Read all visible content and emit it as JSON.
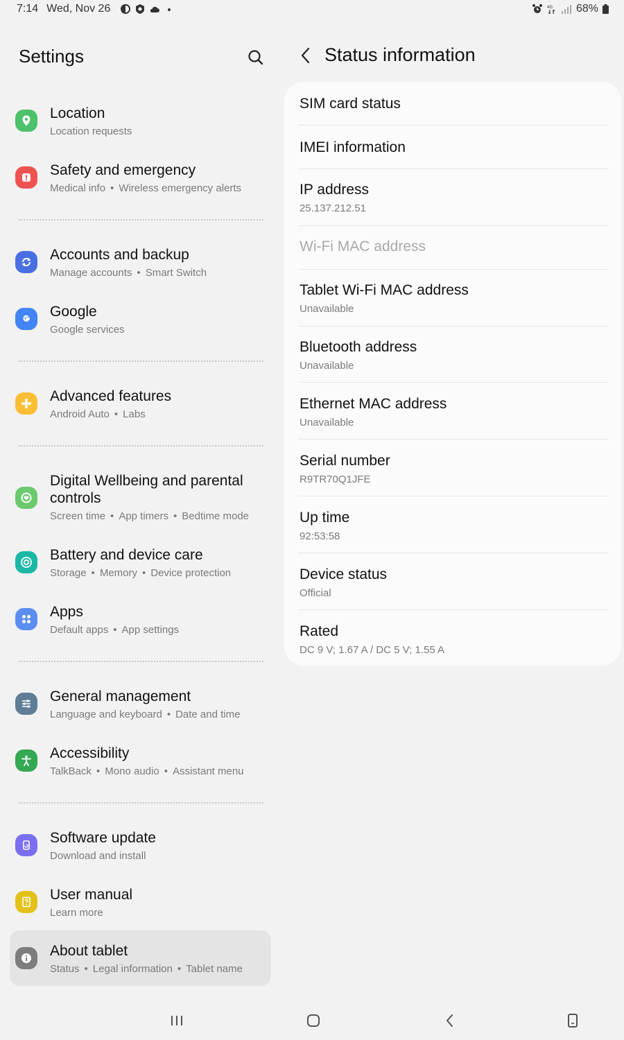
{
  "status_bar": {
    "time": "7:14",
    "date": "Wed, Nov 26",
    "battery": "68%",
    "network_badge": "4G"
  },
  "left": {
    "title": "Settings",
    "items": [
      {
        "title": "Location",
        "subs": [
          "Location requests"
        ],
        "icon": "location-icon",
        "color": "#4cc26b"
      },
      {
        "title": "Safety and emergency",
        "subs": [
          "Medical info",
          "Wireless emergency alerts"
        ],
        "icon": "alert-icon",
        "color": "#ef5350"
      },
      {
        "title": "Accounts and backup",
        "subs": [
          "Manage accounts",
          "Smart Switch"
        ],
        "icon": "sync-icon",
        "color": "#4a6fe3"
      },
      {
        "title": "Google",
        "subs": [
          "Google services"
        ],
        "icon": "google-icon",
        "color": "#4285f4"
      },
      {
        "title": "Advanced features",
        "subs": [
          "Android Auto",
          "Labs"
        ],
        "icon": "puzzle-icon",
        "color": "#fbbf36"
      },
      {
        "title_line1": "Digital Wellbeing and parental",
        "title_line2": "controls",
        "subs": [
          "Screen time",
          "App timers",
          "Bedtime mode"
        ],
        "icon": "wellbeing-icon",
        "color": "#6cc96e"
      },
      {
        "title": "Battery and device care",
        "subs": [
          "Storage",
          "Memory",
          "Device protection"
        ],
        "icon": "device-care-icon",
        "color": "#1bb8a6"
      },
      {
        "title": "Apps",
        "subs": [
          "Default apps",
          "App settings"
        ],
        "icon": "apps-icon",
        "color": "#5b8ef0"
      },
      {
        "title": "General management",
        "subs": [
          "Language and keyboard",
          "Date and time"
        ],
        "icon": "sliders-icon",
        "color": "#5f7d96"
      },
      {
        "title": "Accessibility",
        "subs": [
          "TalkBack",
          "Mono audio",
          "Assistant menu"
        ],
        "icon": "accessibility-icon",
        "color": "#34a853"
      },
      {
        "title": "Software update",
        "subs": [
          "Download and install"
        ],
        "icon": "update-icon",
        "color": "#7a6ff0"
      },
      {
        "title": "User manual",
        "subs": [
          "Learn more"
        ],
        "icon": "manual-icon",
        "color": "#e2c21a"
      },
      {
        "title": "About tablet",
        "subs": [
          "Status",
          "Legal information",
          "Tablet name"
        ],
        "icon": "info-icon",
        "color": "#7d7d7d"
      }
    ]
  },
  "right": {
    "title": "Status information",
    "rows": [
      {
        "title": "SIM card status"
      },
      {
        "title": "IMEI information"
      },
      {
        "title": "IP address",
        "value": "25.137.212.51"
      },
      {
        "title": "Wi-Fi MAC address",
        "disabled": true
      },
      {
        "title": "Tablet Wi-Fi MAC address",
        "value": "Unavailable"
      },
      {
        "title": "Bluetooth address",
        "value": "Unavailable"
      },
      {
        "title": "Ethernet MAC address",
        "value": "Unavailable"
      },
      {
        "title": "Serial number",
        "value": "R9TR70Q1JFE"
      },
      {
        "title": "Up time",
        "value": "92:53:58"
      },
      {
        "title": "Device status",
        "value": "Official"
      },
      {
        "title": "Rated",
        "value": "DC 9 V; 1.67 A / DC 5 V; 1.55 A"
      }
    ]
  },
  "colors": {
    "background": "#f2f2f2",
    "card": "#fbfbfb",
    "selected": "#e4e4e4",
    "subtext": "#7a7a7a"
  }
}
